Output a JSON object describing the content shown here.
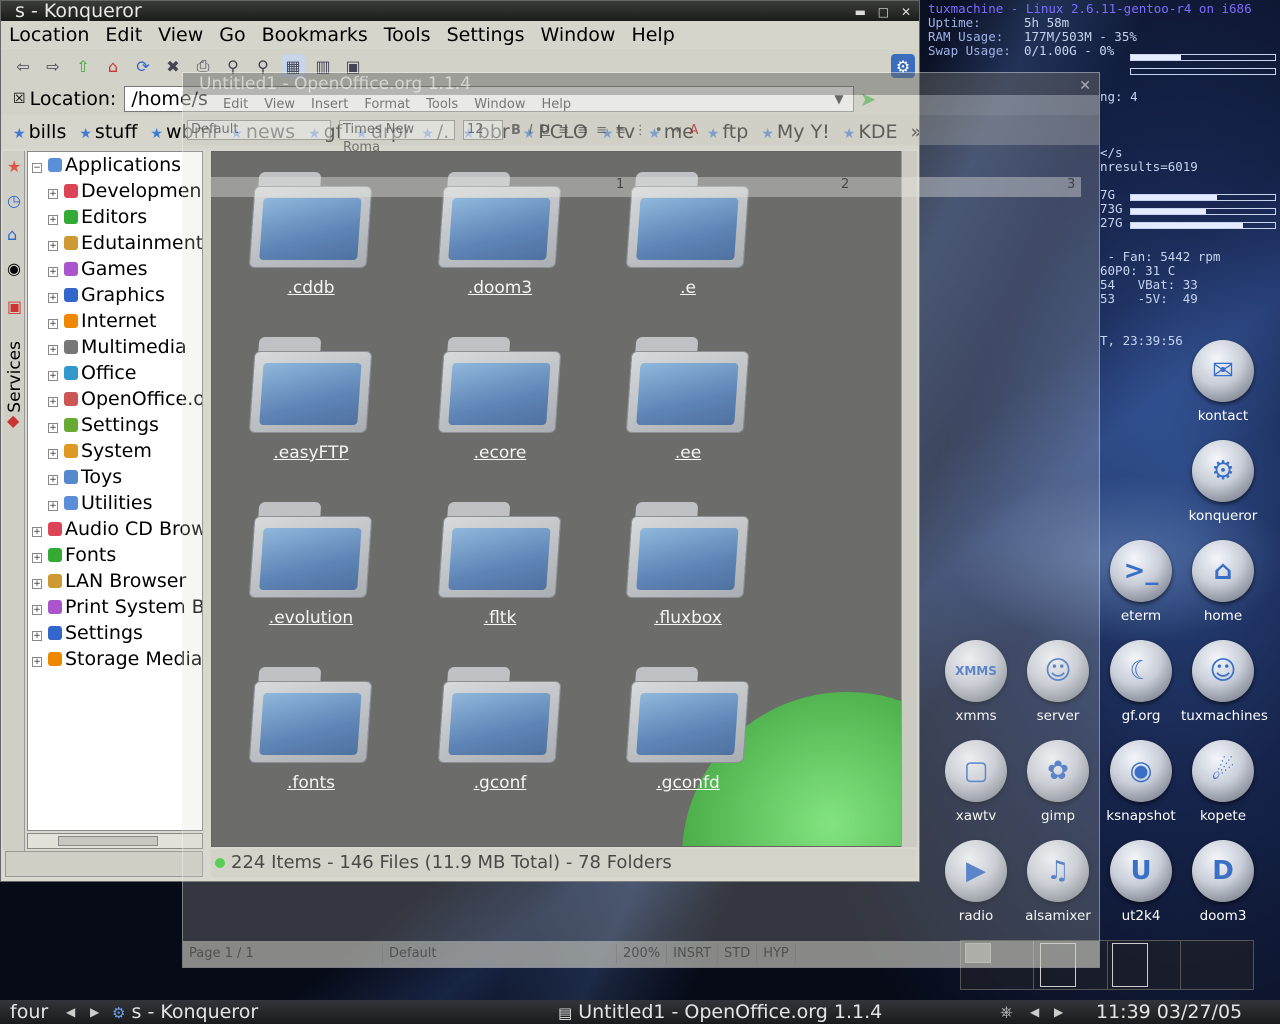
{
  "konqueror": {
    "title": "s - Konqueror",
    "menu": [
      "Location",
      "Edit",
      "View",
      "Go",
      "Bookmarks",
      "Tools",
      "Settings",
      "Window",
      "Help"
    ],
    "location_label": "Location:",
    "location_value": "/home/s",
    "bookmarks": [
      "bills",
      "stuff",
      "wbml",
      "news",
      "gf",
      "drpl",
      "/.",
      "bbr",
      "PCLO",
      "tv",
      "me",
      "ftp",
      "My Y!",
      "KDE"
    ],
    "bookmarks_more": "»",
    "sidebar_tab": "Services",
    "tree": [
      {
        "label": "Applications",
        "level": 0,
        "expanded": true
      },
      {
        "label": "Development",
        "level": 1
      },
      {
        "label": "Editors",
        "level": 1
      },
      {
        "label": "Edutainment",
        "level": 1
      },
      {
        "label": "Games",
        "level": 1
      },
      {
        "label": "Graphics",
        "level": 1
      },
      {
        "label": "Internet",
        "level": 1
      },
      {
        "label": "Multimedia",
        "level": 1
      },
      {
        "label": "Office",
        "level": 1
      },
      {
        "label": "OpenOffice.org",
        "level": 1
      },
      {
        "label": "Settings",
        "level": 1
      },
      {
        "label": "System",
        "level": 1
      },
      {
        "label": "Toys",
        "level": 1
      },
      {
        "label": "Utilities",
        "level": 1
      },
      {
        "label": "Audio CD Browser",
        "level": 0
      },
      {
        "label": "Fonts",
        "level": 0
      },
      {
        "label": "LAN Browser",
        "level": 0
      },
      {
        "label": "Print System Browser",
        "level": 0
      },
      {
        "label": "Settings",
        "level": 0
      },
      {
        "label": "Storage Media",
        "level": 0
      }
    ],
    "files": [
      ".cddb",
      ".doom3",
      ".e",
      ".easyFTP",
      ".ecore",
      ".ee",
      ".evolution",
      ".fltk",
      ".fluxbox",
      ".fonts",
      ".gconf",
      ".gconfd"
    ],
    "status": "224 Items - 146 Files (11.9 MB Total) - 78 Folders"
  },
  "openoffice": {
    "title": "Untitled1 - OpenOffice.org 1.1.4",
    "menu": [
      "Edit",
      "View",
      "Insert",
      "Format",
      "Tools",
      "Window",
      "Help"
    ],
    "style": "Default",
    "font": "Times New Roma",
    "size": "12",
    "ruler": [
      "1",
      "2",
      "3"
    ],
    "status": [
      "Page 1 / 1",
      "Default",
      "200%",
      "INSRT",
      "STD",
      "HYP"
    ]
  },
  "conky": {
    "header": "tuxmachine - Linux 2.6.11-gentoo-r4 on i686",
    "uptime_label": "Uptime:",
    "uptime": "5h 58m",
    "ram_label": "RAM Usage:",
    "ram": "177M/503M - 35%",
    "ram_pct": 35,
    "swap_label": "Swap Usage:",
    "swap": "0/1.00G - 0%",
    "swap_pct": 0,
    "lines": [
      "ng: 4",
      "</s",
      "nresults=6019",
      "7G",
      "73G",
      "27G",
      " - Fan: 5442 rpm",
      "60P0: 31 C",
      "54   VBat: 33",
      "53   -5V:  49",
      "T, 23:39:56"
    ],
    "disk_pct": [
      60,
      52,
      78
    ]
  },
  "desktop_icons": [
    {
      "label": "kontact",
      "glyph": "✉"
    },
    {
      "label": "konqueror",
      "glyph": "⚙"
    },
    {
      "label": "eterm",
      "glyph": ">_"
    },
    {
      "label": "home",
      "glyph": "⌂"
    },
    {
      "label": "xmms",
      "glyph": "XMMS"
    },
    {
      "label": "server",
      "glyph": "☺"
    },
    {
      "label": "gf.org",
      "glyph": "☾"
    },
    {
      "label": "tuxmachines",
      "glyph": "☺"
    },
    {
      "label": "xawtv",
      "glyph": "▢"
    },
    {
      "label": "gimp",
      "glyph": "✿"
    },
    {
      "label": "ksnapshot",
      "glyph": "◉"
    },
    {
      "label": "kopete",
      "glyph": "☄"
    },
    {
      "label": "radio",
      "glyph": "▶"
    },
    {
      "label": "alsamixer",
      "glyph": "♫"
    },
    {
      "label": "ut2k4",
      "glyph": "U"
    },
    {
      "label": "doom3",
      "glyph": "D"
    }
  ],
  "taskbar": {
    "desktop": "four",
    "tasks": [
      "s - Konqueror",
      "Untitled1 - OpenOffice.org 1.1.4"
    ],
    "clock": "11:39  03/27/05"
  }
}
